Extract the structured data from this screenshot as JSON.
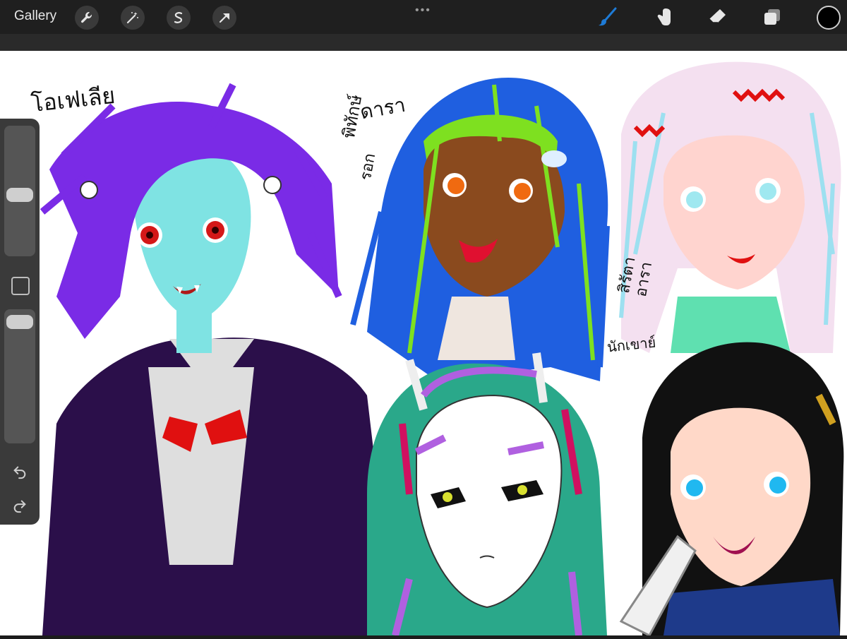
{
  "app": {
    "gallery_label": "Gallery",
    "more_icon": "ellipsis-icon"
  },
  "toolbar_left": [
    {
      "icon": "wrench-icon"
    },
    {
      "icon": "magic-wand-icon"
    },
    {
      "icon": "selection-icon"
    },
    {
      "icon": "transform-arrow-icon"
    }
  ],
  "toolbar_right": [
    {
      "icon": "brush-icon",
      "active": true,
      "color": "#1e7bd6"
    },
    {
      "icon": "smudge-icon"
    },
    {
      "icon": "eraser-icon"
    },
    {
      "icon": "layers-icon"
    }
  ],
  "current_color": "#000000",
  "sidebar": {
    "brush_size_level": 0.55,
    "opacity_level": 0.92,
    "icons": [
      "modify-square-icon",
      "undo-icon",
      "redo-icon"
    ]
  },
  "artwork": {
    "labels": [
      {
        "id": "ophelia",
        "text": "โอเฟเลีย"
      },
      {
        "id": "dara",
        "text": "ดารา"
      },
      {
        "id": "pitak",
        "text": "พิทักษ์"
      },
      {
        "id": "rok",
        "text": "รอก"
      },
      {
        "id": "sirat",
        "text": "สิรัตา"
      },
      {
        "id": "aran",
        "text": "อารา"
      },
      {
        "id": "nakkhao",
        "text": "นักเขาย์"
      }
    ]
  }
}
